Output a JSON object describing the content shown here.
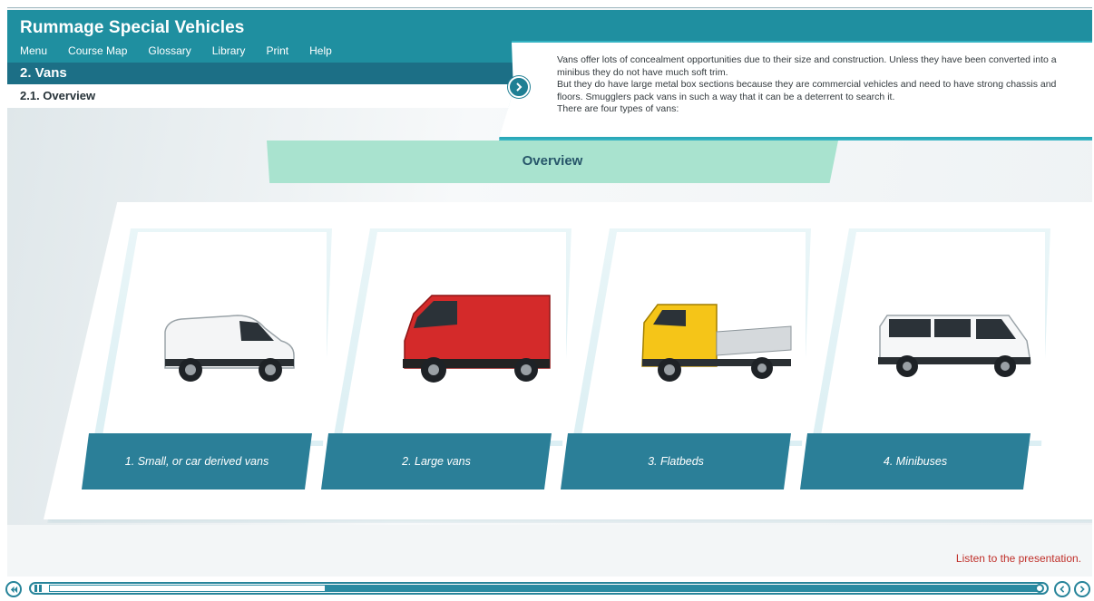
{
  "header": {
    "course_title": "Rummage Special Vehicles",
    "menu": [
      "Menu",
      "Course Map",
      "Glossary",
      "Library",
      "Print",
      "Help"
    ],
    "section": "2. Vans",
    "subsection": "2.1. Overview"
  },
  "description": {
    "lines": [
      "Vans offer lots of concealment opportunities due to their size and construction. Unless they have been converted into a minibus they do not have much soft trim.",
      "But they do have large metal box sections because they are commercial vehicles and need to have strong chassis and floors. Smugglers pack vans in such a way that it can be a deterrent to search it.",
      "There are four types of vans:"
    ]
  },
  "overview": {
    "title": "Overview"
  },
  "cards": [
    {
      "label": "1.  Small, or car derived vans",
      "color": "#ffffff"
    },
    {
      "label": "2.  Large vans",
      "color": "#d42a2a"
    },
    {
      "label": "3.  Flatbeds",
      "color": "#f5c518"
    },
    {
      "label": "4.  Minibuses",
      "color": "#ffffff"
    }
  ],
  "status": {
    "text": "Listen to the presentation."
  },
  "player": {
    "progress_percent": 28
  },
  "colors": {
    "primary": "#1f8fa0",
    "dark": "#1c6f86",
    "accent": "#a9e3cf",
    "label_bar": "#2b7f98",
    "status": "#c0302a"
  }
}
